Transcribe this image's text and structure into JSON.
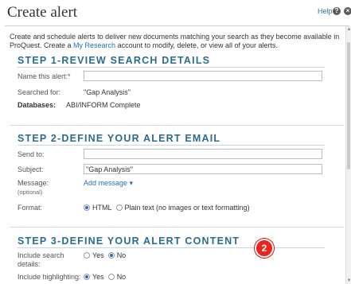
{
  "dialog": {
    "title": "Create alert",
    "help_label": "Help",
    "help_icon": "question-circle-icon",
    "close_icon": "close-circle-icon"
  },
  "intro": {
    "text_before": "Create and schedule alerts to deliver new documents matching your search as they become available in ProQuest. Create a ",
    "link_text": "My Research",
    "text_after": " account to modify, delete, or view all of your alerts."
  },
  "step1": {
    "title": "STEP 1-REVIEW SEARCH DETAILS",
    "name_label": "Name this alert:*",
    "name_value": "",
    "searched_label": "Searched for:",
    "searched_value": "\"Gap Analysis\"",
    "databases_label": "Databases:",
    "databases_value": "ABI/INFORM Complete"
  },
  "step2": {
    "title": "STEP 2-DEFINE YOUR ALERT EMAIL",
    "send_to_label": "Send to:",
    "send_to_value": "",
    "subject_label": "Subject:",
    "subject_value": "\"Gap Analysis\"",
    "message_label": "Message:",
    "message_sub": "(optional)",
    "add_message_link": "Add message ▾",
    "format_label": "Format:",
    "format_options": [
      "HTML",
      "Plain text (no images or text formatting)"
    ],
    "format_selected": "HTML"
  },
  "step3": {
    "title": "STEP 3-DEFINE YOUR ALERT CONTENT",
    "include_search_label": "Include search details:",
    "include_search_options": [
      "Yes",
      "No"
    ],
    "include_search_selected": "No",
    "include_highlight_label": "Include highlighting:",
    "include_highlight_options": [
      "Yes",
      "No"
    ],
    "include_highlight_selected": "Yes"
  },
  "annotation": {
    "badge": "2",
    "badge_color": "#e8261d"
  },
  "colors": {
    "step_title": "#2b6c8c",
    "link": "#2a6fb7",
    "radio_checked": "#3366cc"
  }
}
